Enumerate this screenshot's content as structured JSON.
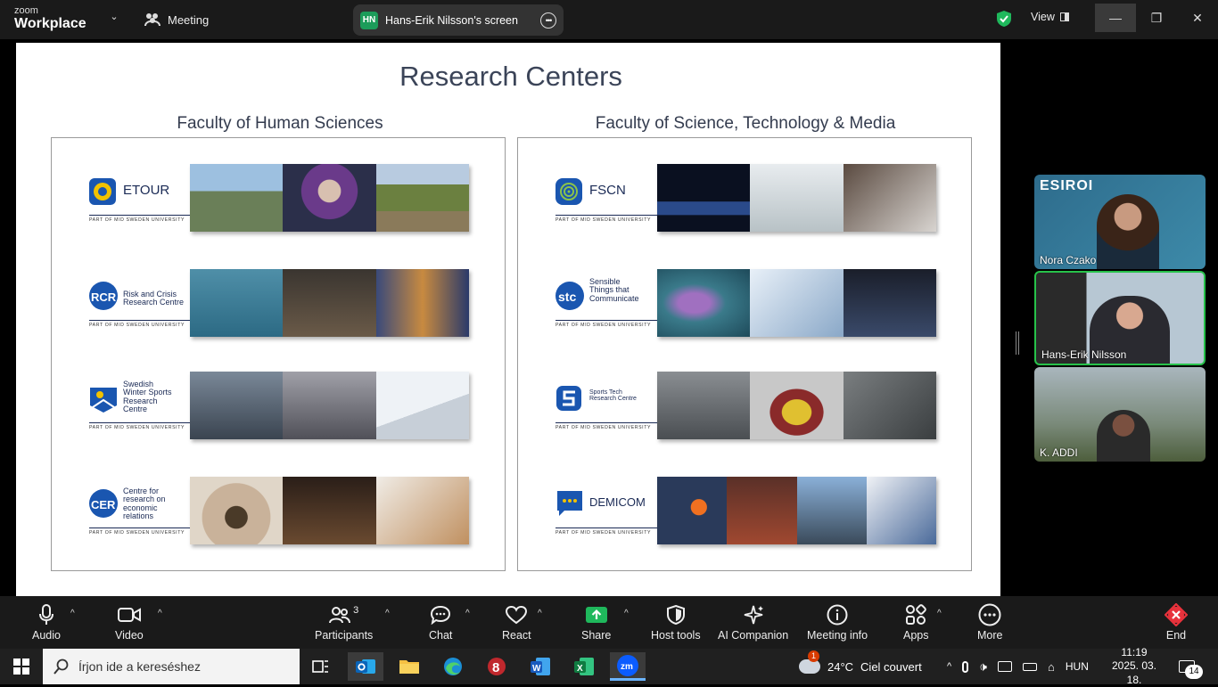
{
  "topbar": {
    "brand_small": "zoom",
    "brand_large": "Workplace",
    "meeting_label": "Meeting",
    "share_initials": "HN",
    "share_label": "Hans-Erik Nilsson's screen",
    "view_label": "View"
  },
  "slide": {
    "title": "Research Centers",
    "left_faculty": {
      "title": "Faculty of Human Sciences",
      "centers": [
        {
          "name": "ETOUR",
          "sub": "PART OF MID SWEDEN UNIVERSITY",
          "mark_color": "#1a56b0"
        },
        {
          "name": "Risk and Crisis\nResearch Centre",
          "abbr": "RCR",
          "sub": "PART OF MID SWEDEN UNIVERSITY",
          "mark_color": "#1a56b0"
        },
        {
          "name": "Swedish\nWinter Sports\nResearch\nCentre",
          "sub": "PART OF MID SWEDEN UNIVERSITY",
          "mark_color": "#1a56b0"
        },
        {
          "name": "Centre for\nresearch on\neconomic\nrelations",
          "abbr": "CER",
          "sub": "PART OF MID SWEDEN UNIVERSITY",
          "mark_color": "#1a56b0"
        }
      ]
    },
    "right_faculty": {
      "title": "Faculty of Science, Technology & Media",
      "centers": [
        {
          "name": "FSCN",
          "sub": "PART OF MID SWEDEN UNIVERSITY",
          "mark_color": "#1a56b0"
        },
        {
          "name": "Sensible\nThings that\nCommunicate",
          "abbr": "stc",
          "sub": "PART OF MID SWEDEN UNIVERSITY",
          "mark_color": "#1a56b0"
        },
        {
          "name": "Sports Tech\nResearch Centre",
          "sub": "PART OF MID SWEDEN UNIVERSITY",
          "mark_color": "#1a56b0"
        },
        {
          "name": "DEMICOM",
          "sub": "PART OF MID SWEDEN UNIVERSITY",
          "mark_color": "#1a56b0"
        }
      ]
    }
  },
  "participants": [
    {
      "name": "Nora Czako",
      "overlay": "ESIROI"
    },
    {
      "name": "Hans-Erik Nilsson"
    },
    {
      "name": "K. ADDI"
    }
  ],
  "toolbar": {
    "audio": "Audio",
    "video": "Video",
    "participants": "Participants",
    "participants_count": "3",
    "chat": "Chat",
    "react": "React",
    "share": "Share",
    "host_tools": "Host tools",
    "ai_companion": "AI Companion",
    "meeting_info": "Meeting info",
    "apps": "Apps",
    "more": "More",
    "end": "End"
  },
  "taskbar": {
    "search_placeholder": "Írjon ide a kereséshez",
    "weather_temp": "24°C",
    "weather_text": "Ciel couvert",
    "weather_badge": "1",
    "language": "HUN",
    "time": "11:19",
    "date": "2025. 03. 18.",
    "notifications": "14"
  },
  "colors": {
    "accent_green": "#1c9c5a",
    "share_green": "#1fb85c",
    "end_red": "#e8323c",
    "slide_text": "#3b4458"
  }
}
